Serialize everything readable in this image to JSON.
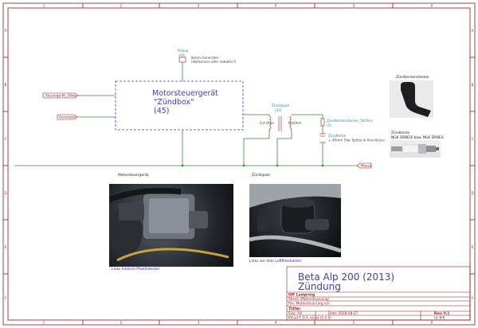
{
  "sheet": {
    "border_color": "#8b1a1a",
    "wire_color": "#2e8b2e",
    "box_color": "#3b3bc8",
    "col_markers_top": [
      "1",
      "2",
      "3",
      "4",
      "5",
      "6"
    ],
    "col_markers_bottom": [
      "1",
      "2",
      "3",
      "4",
      "5",
      "6"
    ],
    "row_markers_left": [
      "A",
      "B",
      "C",
      "D",
      "E",
      "F"
    ],
    "row_markers_right": [
      "A",
      "B",
      "C",
      "D",
      "E",
      "F"
    ]
  },
  "ecu": {
    "title_line1": "Motorsteuergerät",
    "title_line2": "\"Zündbox\"",
    "title_line3": "(45)"
  },
  "pickup": {
    "label": "Pickup",
    "ref": "(43)",
    "desc1": "8ohm Generator",
    "desc2": "(Hallsensor oder induktiv?)"
  },
  "ports": {
    "steuergeraet": "SteuergerBt_30kw",
    "generator": "Generator"
  },
  "coil": {
    "label": "Zündspule",
    "ref": "(33)",
    "primary": "0,4 Ohm",
    "secondary": "6 kOhm"
  },
  "connector": {
    "label": "Zündkerzenstecker_5kOhm",
    "ref": "(1)"
  },
  "plug": {
    "label": "Zündkerze",
    "desc": "+ 40mm (Sw. Spitze & Anschluss)"
  },
  "ground_label": "Masse",
  "side_captions": {
    "stecker": "Zündkerzenstecker",
    "kerze_title": "Zündkerze",
    "kerze_desc": "NGK DR8EIX bzw. NGK DR8EA"
  },
  "photos": {
    "photo1_title": "Motorsteuergerät",
    "photo1_caption": "Links hinterm Plastikdeckel",
    "photo2_title": "Zündspule",
    "photo2_caption": "Links vor dem Luftfilterkasten"
  },
  "title_block": {
    "project": "Beta Alp 200 (2013)",
    "subtitle": "Zündung",
    "company": "UIF Lampring",
    "sheet": "Sheet: /Motorsteuerung/",
    "file": "File: Motorsteuerung.sch",
    "title_label": "Title:",
    "size": "Size: A4",
    "date": "Date: 2018-08-27",
    "rev": "Rev: 0.1",
    "kicad": "KiCad E.D.A.  kicad (5.0.0)",
    "id": "Id: 6/6"
  }
}
